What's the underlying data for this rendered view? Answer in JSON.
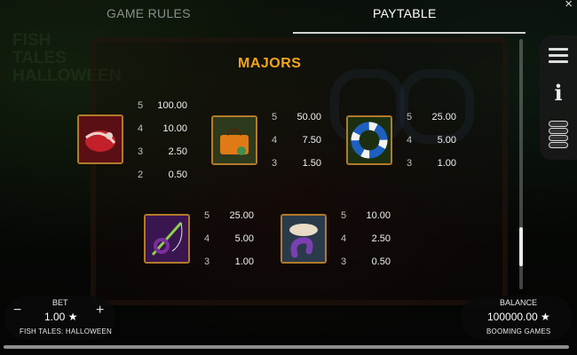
{
  "tabs": {
    "rules": "GAME RULES",
    "paytable": "PAYTABLE",
    "close": "×"
  },
  "backdrop": {
    "logo": "FISH TALES HALLOWEEN"
  },
  "section_title": "MAJORS",
  "symbols": [
    {
      "name": "red-lure",
      "colors": [
        "#c2202a",
        "#e7d3c9"
      ],
      "pays": [
        {
          "count": "5",
          "value": "100.00"
        },
        {
          "count": "4",
          "value": "10.00"
        },
        {
          "count": "3",
          "value": "2.50"
        },
        {
          "count": "2",
          "value": "0.50"
        }
      ]
    },
    {
      "name": "tackle-box",
      "colors": [
        "#e07a17",
        "#3f8f4a"
      ],
      "pays": [
        {
          "count": "5",
          "value": "50.00"
        },
        {
          "count": "4",
          "value": "7.50"
        },
        {
          "count": "3",
          "value": "1.50"
        }
      ]
    },
    {
      "name": "life-ring",
      "colors": [
        "#1f5fc0",
        "#f2f2f2"
      ],
      "pays": [
        {
          "count": "5",
          "value": "25.00"
        },
        {
          "count": "4",
          "value": "5.00"
        },
        {
          "count": "3",
          "value": "1.00"
        }
      ]
    },
    {
      "name": "fishing-rod",
      "colors": [
        "#7a2f9a",
        "#8bd04c"
      ],
      "pays": [
        {
          "count": "5",
          "value": "25.00"
        },
        {
          "count": "4",
          "value": "5.00"
        },
        {
          "count": "3",
          "value": "1.00"
        }
      ]
    },
    {
      "name": "bait-worm",
      "colors": [
        "#7a3fb0",
        "#e8dcc4"
      ],
      "pays": [
        {
          "count": "5",
          "value": "10.00"
        },
        {
          "count": "4",
          "value": "2.50"
        },
        {
          "count": "3",
          "value": "0.50"
        }
      ]
    }
  ],
  "bet": {
    "label": "BET",
    "value": "1.00 ★",
    "minus": "−",
    "plus": "+"
  },
  "balance": {
    "label": "BALANCE",
    "value": "100000.00 ★"
  },
  "footer": {
    "game": "FISH TALES: HALLOWEEN",
    "studio": "BOOMING GAMES"
  },
  "colors": {
    "accent": "#f5a518",
    "frame": "#b27a2a"
  }
}
